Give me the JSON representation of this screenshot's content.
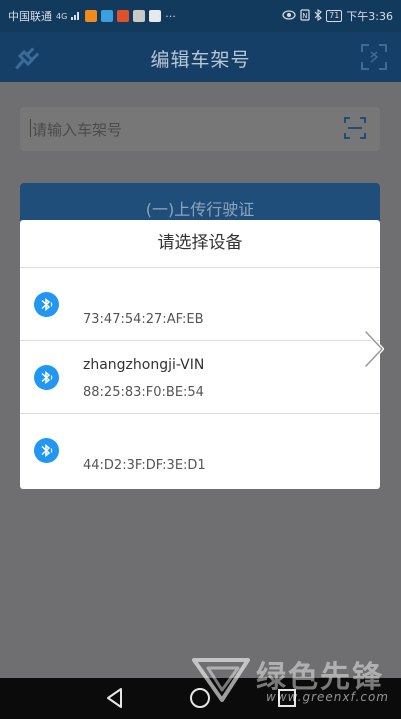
{
  "status_bar": {
    "carrier": "中国联通",
    "signal_text": "4G",
    "notifications_more": "···",
    "battery": "71",
    "time": "下午3:36"
  },
  "app_bar": {
    "title": "编辑车架号",
    "left_icon": "plug-icon",
    "right_icon": "scan-icon"
  },
  "vin_input": {
    "placeholder": "请输入车架号",
    "value": ""
  },
  "verify_button": {
    "label": "(一)上传行驶证"
  },
  "device_dialog": {
    "title": "请选择设备",
    "devices": [
      {
        "name": "",
        "mac": "73:47:54:27:AF:EB"
      },
      {
        "name": "zhangzhongji-VIN",
        "mac": "88:25:83:F0:BE:54"
      },
      {
        "name": "",
        "mac": "44:D2:3F:DF:3E:D1"
      }
    ]
  },
  "watermark": {
    "brand": "绿色先锋",
    "url": "www.greenxf.com"
  },
  "colors": {
    "app_bar": "#153f66",
    "bluetooth": "#2196f3",
    "overlay_bg": "#6f6f72"
  }
}
